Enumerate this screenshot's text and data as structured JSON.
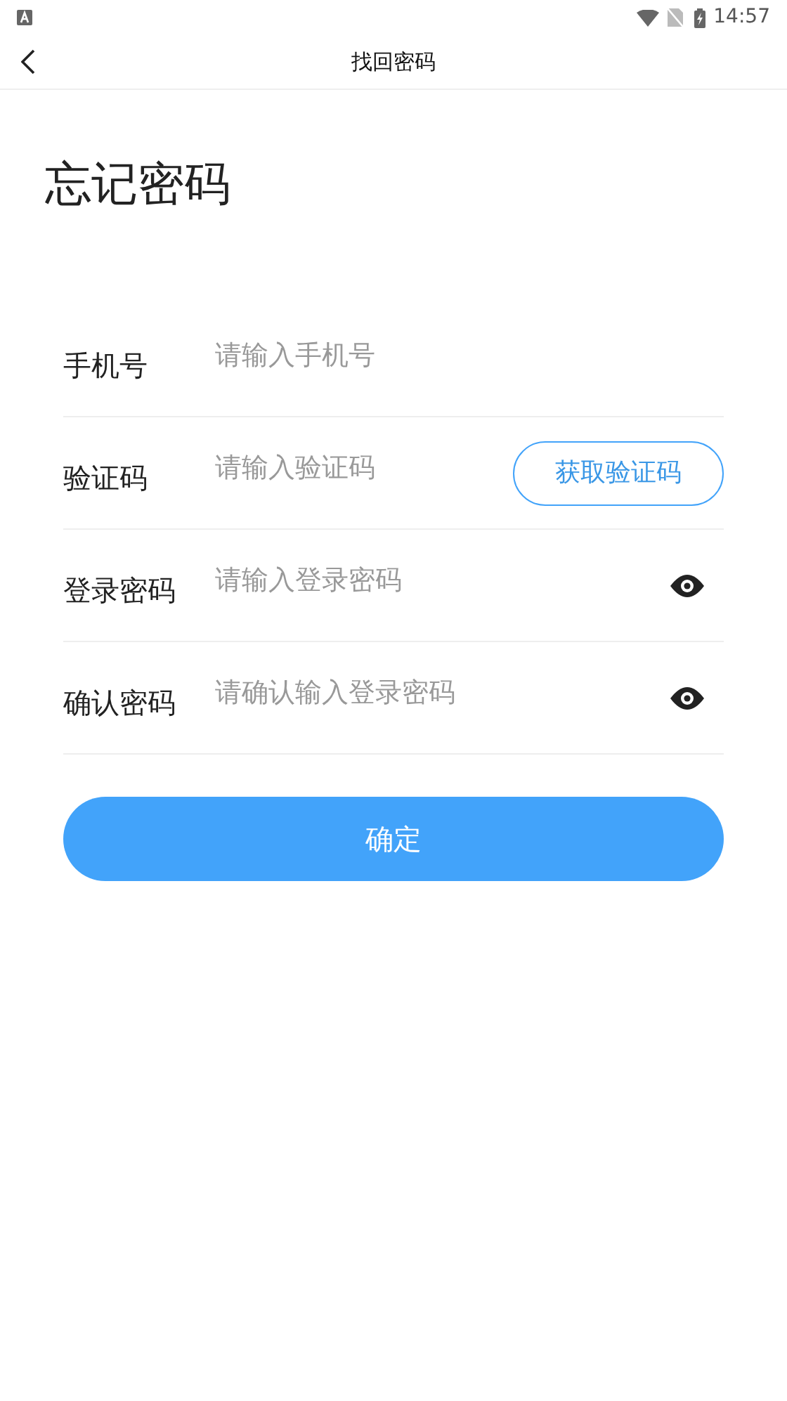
{
  "status_bar": {
    "time": "14:57"
  },
  "header": {
    "title": "找回密码"
  },
  "heading": "忘记密码",
  "fields": [
    {
      "kind": "plain",
      "label": "手机号",
      "placeholder": "请输入手机号"
    },
    {
      "kind": "code",
      "label": "验证码",
      "placeholder": "请输入验证码",
      "button": "获取验证码"
    },
    {
      "kind": "password",
      "label": "登录密码",
      "placeholder": "请输入登录密码"
    },
    {
      "kind": "password",
      "label": "确认密码",
      "placeholder": "请确认输入登录密码"
    }
  ],
  "submit": "确定"
}
